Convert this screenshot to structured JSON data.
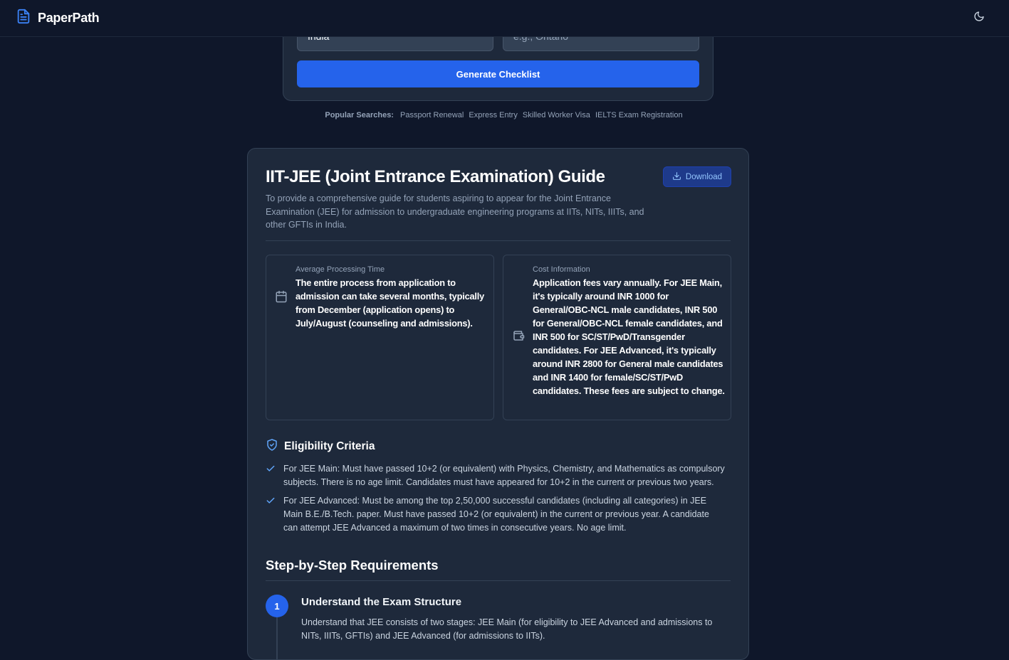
{
  "app": {
    "name": "PaperPath"
  },
  "nav": {
    "theme_icon": "moon-icon"
  },
  "search_form": {
    "country_value": "India",
    "province_placeholder": "e.g., Ontario",
    "generate_label": "Generate Checklist"
  },
  "popular": {
    "label": "Popular Searches:",
    "items": [
      "Passport Renewal",
      "Express Entry",
      "Skilled Worker Visa",
      "IELTS Exam Registration"
    ]
  },
  "guide": {
    "title": "IIT-JEE (Joint Entrance Examination) Guide",
    "description": "To provide a comprehensive guide for students aspiring to appear for the Joint Entrance Examination (JEE) for admission to undergraduate engineering programs at IITs, NITs, IIITs, and other GFTIs in India.",
    "download_label": "Download",
    "processing": {
      "label": "Average Processing Time",
      "value": "The entire process from application to admission can take several months, typically from December (application opens) to July/August (counseling and admissions)."
    },
    "cost": {
      "label": "Cost Information",
      "value": "Application fees vary annually. For JEE Main, it's typically around INR 1000 for General/OBC-NCL male candidates, INR 500 for General/OBC-NCL female candidates, and INR 500 for SC/ST/PwD/Transgender candidates. For JEE Advanced, it's typically around INR 2800 for General male candidates and INR 1400 for female/SC/ST/PwD candidates. These fees are subject to change."
    },
    "eligibility": {
      "title": "Eligibility Criteria",
      "items": [
        "For JEE Main: Must have passed 10+2 (or equivalent) with Physics, Chemistry, and Mathematics as compulsory subjects. There is no age limit. Candidates must have appeared for 10+2 in the current or previous two years.",
        "For JEE Advanced: Must be among the top 2,50,000 successful candidates (including all categories) in JEE Main B.E./B.Tech. paper. Must have passed 10+2 (or equivalent) in the current or previous year. A candidate can attempt JEE Advanced a maximum of two times in consecutive years. No age limit."
      ]
    },
    "steps": {
      "title": "Step-by-Step Requirements",
      "items": [
        {
          "number": "1",
          "title": "Understand the Exam Structure",
          "description": "Understand that JEE consists of two stages: JEE Main (for eligibility to JEE Advanced and admissions to NITs, IIITs, GFTIs) and JEE Advanced (for admissions to IITs)."
        }
      ]
    }
  },
  "colors": {
    "background": "#0f172a",
    "card": "#1e293b",
    "accent": "#2563eb",
    "accent_light": "#60a5fa"
  }
}
